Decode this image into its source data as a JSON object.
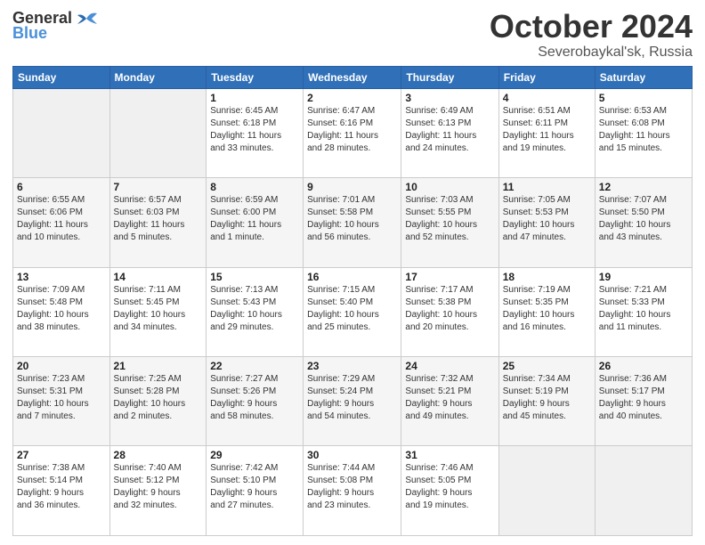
{
  "header": {
    "logo_line1": "General",
    "logo_line2": "Blue",
    "title": "October 2024",
    "subtitle": "Severobaykal'sk, Russia"
  },
  "weekdays": [
    "Sunday",
    "Monday",
    "Tuesday",
    "Wednesday",
    "Thursday",
    "Friday",
    "Saturday"
  ],
  "weeks": [
    [
      {
        "day": "",
        "detail": ""
      },
      {
        "day": "",
        "detail": ""
      },
      {
        "day": "1",
        "detail": "Sunrise: 6:45 AM\nSunset: 6:18 PM\nDaylight: 11 hours\nand 33 minutes."
      },
      {
        "day": "2",
        "detail": "Sunrise: 6:47 AM\nSunset: 6:16 PM\nDaylight: 11 hours\nand 28 minutes."
      },
      {
        "day": "3",
        "detail": "Sunrise: 6:49 AM\nSunset: 6:13 PM\nDaylight: 11 hours\nand 24 minutes."
      },
      {
        "day": "4",
        "detail": "Sunrise: 6:51 AM\nSunset: 6:11 PM\nDaylight: 11 hours\nand 19 minutes."
      },
      {
        "day": "5",
        "detail": "Sunrise: 6:53 AM\nSunset: 6:08 PM\nDaylight: 11 hours\nand 15 minutes."
      }
    ],
    [
      {
        "day": "6",
        "detail": "Sunrise: 6:55 AM\nSunset: 6:06 PM\nDaylight: 11 hours\nand 10 minutes."
      },
      {
        "day": "7",
        "detail": "Sunrise: 6:57 AM\nSunset: 6:03 PM\nDaylight: 11 hours\nand 5 minutes."
      },
      {
        "day": "8",
        "detail": "Sunrise: 6:59 AM\nSunset: 6:00 PM\nDaylight: 11 hours\nand 1 minute."
      },
      {
        "day": "9",
        "detail": "Sunrise: 7:01 AM\nSunset: 5:58 PM\nDaylight: 10 hours\nand 56 minutes."
      },
      {
        "day": "10",
        "detail": "Sunrise: 7:03 AM\nSunset: 5:55 PM\nDaylight: 10 hours\nand 52 minutes."
      },
      {
        "day": "11",
        "detail": "Sunrise: 7:05 AM\nSunset: 5:53 PM\nDaylight: 10 hours\nand 47 minutes."
      },
      {
        "day": "12",
        "detail": "Sunrise: 7:07 AM\nSunset: 5:50 PM\nDaylight: 10 hours\nand 43 minutes."
      }
    ],
    [
      {
        "day": "13",
        "detail": "Sunrise: 7:09 AM\nSunset: 5:48 PM\nDaylight: 10 hours\nand 38 minutes."
      },
      {
        "day": "14",
        "detail": "Sunrise: 7:11 AM\nSunset: 5:45 PM\nDaylight: 10 hours\nand 34 minutes."
      },
      {
        "day": "15",
        "detail": "Sunrise: 7:13 AM\nSunset: 5:43 PM\nDaylight: 10 hours\nand 29 minutes."
      },
      {
        "day": "16",
        "detail": "Sunrise: 7:15 AM\nSunset: 5:40 PM\nDaylight: 10 hours\nand 25 minutes."
      },
      {
        "day": "17",
        "detail": "Sunrise: 7:17 AM\nSunset: 5:38 PM\nDaylight: 10 hours\nand 20 minutes."
      },
      {
        "day": "18",
        "detail": "Sunrise: 7:19 AM\nSunset: 5:35 PM\nDaylight: 10 hours\nand 16 minutes."
      },
      {
        "day": "19",
        "detail": "Sunrise: 7:21 AM\nSunset: 5:33 PM\nDaylight: 10 hours\nand 11 minutes."
      }
    ],
    [
      {
        "day": "20",
        "detail": "Sunrise: 7:23 AM\nSunset: 5:31 PM\nDaylight: 10 hours\nand 7 minutes."
      },
      {
        "day": "21",
        "detail": "Sunrise: 7:25 AM\nSunset: 5:28 PM\nDaylight: 10 hours\nand 2 minutes."
      },
      {
        "day": "22",
        "detail": "Sunrise: 7:27 AM\nSunset: 5:26 PM\nDaylight: 9 hours\nand 58 minutes."
      },
      {
        "day": "23",
        "detail": "Sunrise: 7:29 AM\nSunset: 5:24 PM\nDaylight: 9 hours\nand 54 minutes."
      },
      {
        "day": "24",
        "detail": "Sunrise: 7:32 AM\nSunset: 5:21 PM\nDaylight: 9 hours\nand 49 minutes."
      },
      {
        "day": "25",
        "detail": "Sunrise: 7:34 AM\nSunset: 5:19 PM\nDaylight: 9 hours\nand 45 minutes."
      },
      {
        "day": "26",
        "detail": "Sunrise: 7:36 AM\nSunset: 5:17 PM\nDaylight: 9 hours\nand 40 minutes."
      }
    ],
    [
      {
        "day": "27",
        "detail": "Sunrise: 7:38 AM\nSunset: 5:14 PM\nDaylight: 9 hours\nand 36 minutes."
      },
      {
        "day": "28",
        "detail": "Sunrise: 7:40 AM\nSunset: 5:12 PM\nDaylight: 9 hours\nand 32 minutes."
      },
      {
        "day": "29",
        "detail": "Sunrise: 7:42 AM\nSunset: 5:10 PM\nDaylight: 9 hours\nand 27 minutes."
      },
      {
        "day": "30",
        "detail": "Sunrise: 7:44 AM\nSunset: 5:08 PM\nDaylight: 9 hours\nand 23 minutes."
      },
      {
        "day": "31",
        "detail": "Sunrise: 7:46 AM\nSunset: 5:05 PM\nDaylight: 9 hours\nand 19 minutes."
      },
      {
        "day": "",
        "detail": ""
      },
      {
        "day": "",
        "detail": ""
      }
    ]
  ]
}
